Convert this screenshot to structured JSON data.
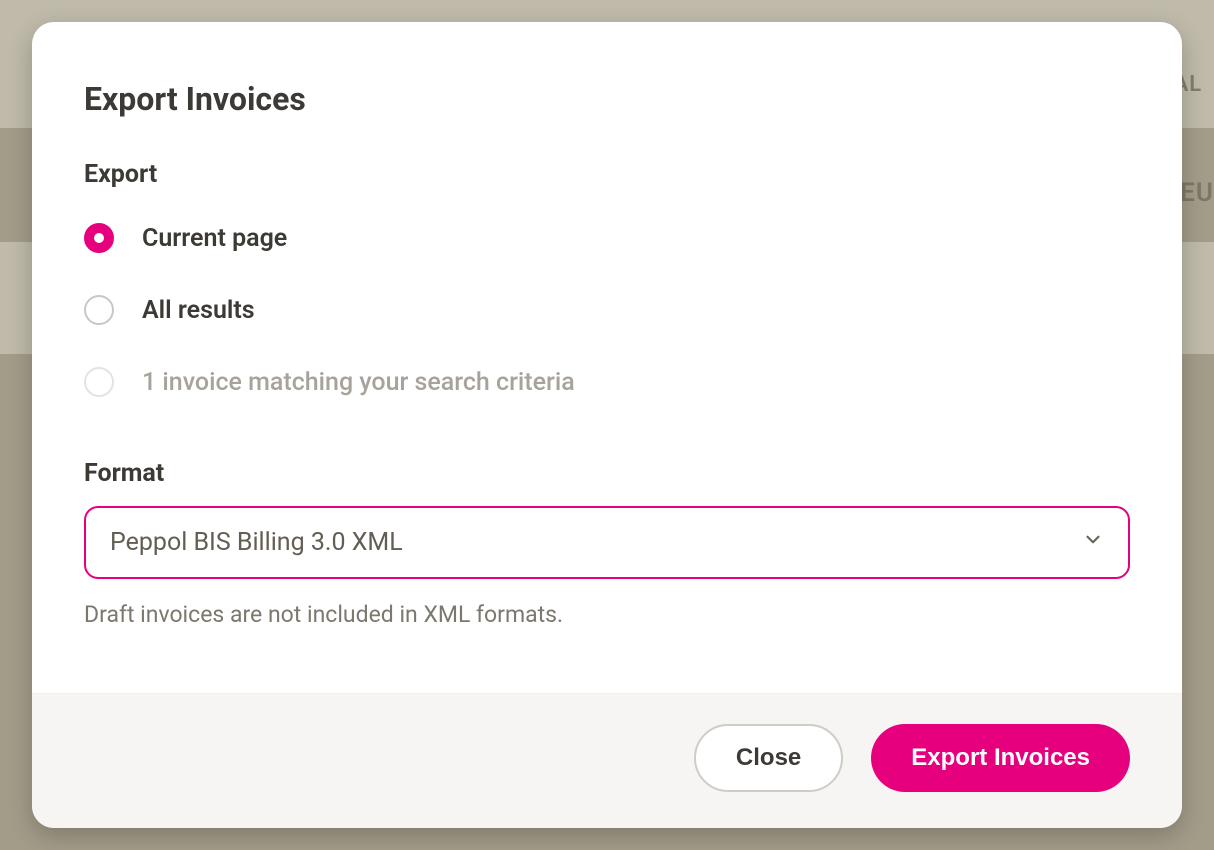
{
  "background": {
    "snippet_right_top": "AL",
    "snippet_right_mid": "EU"
  },
  "modal": {
    "title": "Export Invoices",
    "export": {
      "section_title": "Export",
      "options": {
        "current_page": {
          "label": "Current page",
          "selected": true,
          "disabled": false
        },
        "all_results": {
          "label": "All results",
          "selected": false,
          "disabled": false
        },
        "matching": {
          "label": "1 invoice matching your search criteria",
          "selected": false,
          "disabled": true
        }
      }
    },
    "format": {
      "label": "Format",
      "selected": "Peppol BIS Billing 3.0 XML",
      "helper": "Draft invoices are not included in XML formats."
    },
    "footer": {
      "close": "Close",
      "export": "Export Invoices"
    }
  },
  "colors": {
    "accent": "#e6007e"
  }
}
